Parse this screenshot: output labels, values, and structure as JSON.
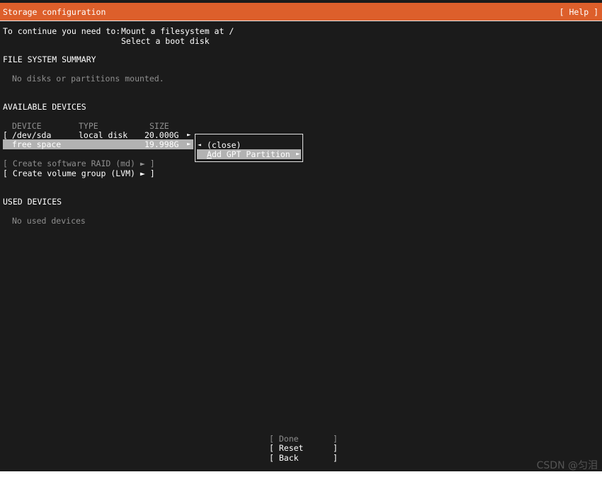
{
  "header": {
    "title": "Storage configuration",
    "help": "[ Help ]"
  },
  "instructions": {
    "prefix": "To continue you need to:",
    "item1": "Mount a filesystem at /",
    "item2": "Select a boot disk"
  },
  "fs_summary": {
    "heading": "FILE SYSTEM SUMMARY",
    "empty": "No disks or partitions mounted."
  },
  "available": {
    "heading": "AVAILABLE DEVICES",
    "col_device": "DEVICE",
    "col_type": "TYPE",
    "col_size": "SIZE",
    "disk": {
      "bracket": "[",
      "name": "/dev/sda",
      "type": "local disk",
      "size": "20.000G",
      "arrow": "►"
    },
    "free": {
      "name": "free space",
      "size": "19.998G",
      "arrow": "►"
    },
    "raid_action": "[ Create software RAID (md) ► ]",
    "lvm_action": "[ Create volume group (LVM) ► ]"
  },
  "popup": {
    "close_arrow": "◄",
    "close_label": "(close)",
    "add_first_letter": "A",
    "add_rest": "dd GPT Partition",
    "add_arrow": "►"
  },
  "used": {
    "heading": "USED DEVICES",
    "empty": "No used devices"
  },
  "footer": {
    "done": "[ Done       ]",
    "reset": "[ Reset      ]",
    "back": "[ Back       ]"
  },
  "watermark": "CSDN @匀泪",
  "colors": {
    "title_bar": "#dd5f2b",
    "background": "#1b1b1b",
    "selection": "#b2b2b2"
  }
}
